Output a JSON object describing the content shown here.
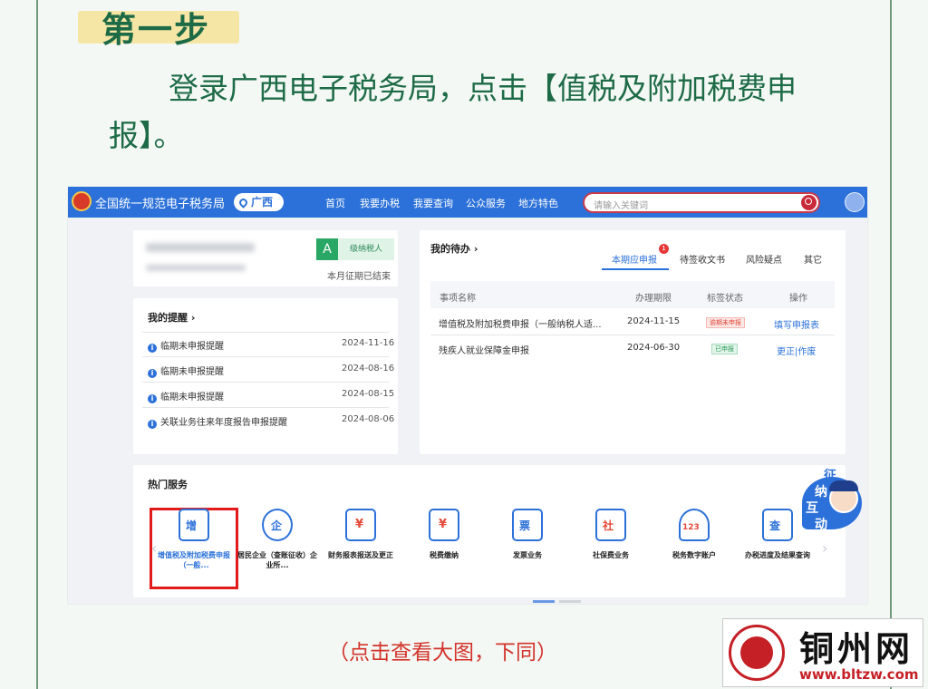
{
  "step_label": "第一步",
  "intro": "登录广西电子税务局，点击【值税及附加税费申报】。",
  "site": {
    "title": "全国统一规范电子税务局",
    "region": "广西",
    "nav": [
      "首页",
      "我要办税",
      "我要查询",
      "公众服务",
      "地方特色"
    ],
    "search_placeholder": "请输入关键词"
  },
  "account": {
    "grade": "A",
    "grade_label": "级纳税人",
    "period_status": "本月征期已结束"
  },
  "reminders": {
    "title": "我的提醒 ›",
    "items": [
      {
        "text": "临期未申报提醒",
        "date": "2024-11-16"
      },
      {
        "text": "临期未申报提醒",
        "date": "2024-08-16"
      },
      {
        "text": "临期未申报提醒",
        "date": "2024-08-15"
      },
      {
        "text": "关联业务往来年度报告申报提醒",
        "date": "2024-08-06"
      }
    ]
  },
  "todo": {
    "title": "我的待办 ›",
    "tabs": [
      "本期应申报",
      "待签收文书",
      "风险疑点",
      "其它"
    ],
    "active_badge": "1",
    "columns": [
      "事项名称",
      "办理期限",
      "标签状态",
      "操作"
    ],
    "rows": [
      {
        "name": "增值税及附加税费申报（一般纳税人适...",
        "deadline": "2024-11-15",
        "status": "逾期未申报",
        "action": "填写申报表"
      },
      {
        "name": "残疾人就业保障金申报",
        "deadline": "2024-06-30",
        "status": "已申报",
        "action": "更正|作废"
      }
    ]
  },
  "hot_services": {
    "title": "热门服务",
    "items": [
      {
        "label": "增值税及附加税费申报（一般...",
        "icon": "增"
      },
      {
        "label": "居民企业（查账征收）企业所...",
        "icon": "企"
      },
      {
        "label": "财务报表报送及更正",
        "icon": "¥"
      },
      {
        "label": "税费缴纳",
        "icon": "¥"
      },
      {
        "label": "发票业务",
        "icon": "票"
      },
      {
        "label": "社保费业务",
        "icon": "社"
      },
      {
        "label": "税务数字账户",
        "icon": "123"
      },
      {
        "label": "办税进度及结果查询",
        "icon": "查"
      }
    ]
  },
  "assistant": [
    "征",
    "纳",
    "互",
    "动"
  ],
  "caption": "（点击查看大图，下同）",
  "watermark": {
    "name": "铜州网",
    "url": "www.bltzw.com"
  }
}
